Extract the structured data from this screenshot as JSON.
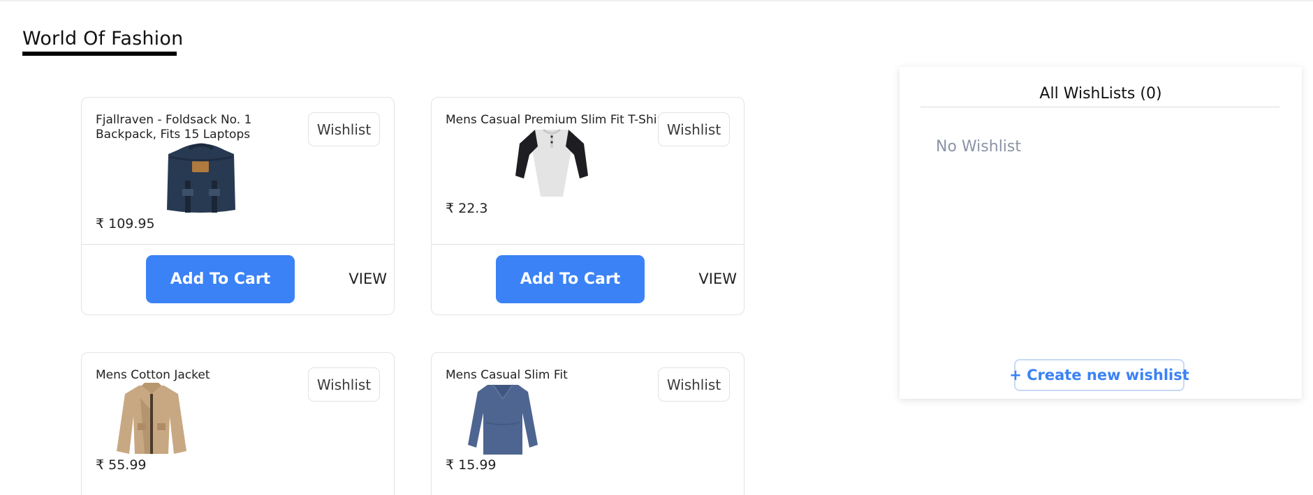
{
  "page": {
    "title": "World Of Fashion"
  },
  "products": [
    {
      "name": "Fjallraven - Foldsack No. 1 Backpack, Fits 15 Laptops",
      "price": "₹ 109.95",
      "wishlist_label": "Wishlist",
      "add_to_cart_label": "Add To Cart",
      "view_label": "VIEW",
      "image": "backpack-image"
    },
    {
      "name": "Mens Casual Premium Slim Fit T-Shirts",
      "price": "₹ 22.3",
      "wishlist_label": "Wishlist",
      "add_to_cart_label": "Add To Cart",
      "view_label": "VIEW",
      "image": "tshirt-image"
    },
    {
      "name": "Mens Cotton Jacket",
      "price": "₹ 55.99",
      "wishlist_label": "Wishlist",
      "image": "jacket-image"
    },
    {
      "name": "Mens Casual Slim Fit",
      "price": "₹ 15.99",
      "wishlist_label": "Wishlist",
      "image": "longsleeve-image"
    }
  ],
  "wishlist_panel": {
    "title": "All WishLists (0)",
    "empty_text": "No Wishlist",
    "create_label": "+ Create new wishlist"
  },
  "colors": {
    "accent": "#3b82f6",
    "muted_text": "#8b93a6"
  }
}
